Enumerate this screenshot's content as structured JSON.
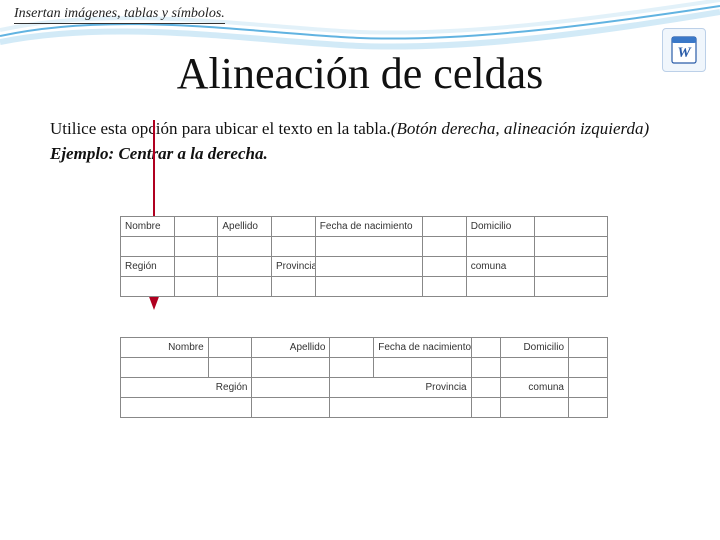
{
  "breadcrumb": "Insertan imágenes, tablas y símbolos.",
  "title": "Alineación de celdas",
  "body": {
    "line1": "Utilice esta opción para ubicar el texto en la tabla.",
    "paren": "(Botón derecha, alineación izquierda)",
    "example_label": "Ejemplo: Centrar a la derecha."
  },
  "icons": {
    "word": "word-icon"
  },
  "table_a": {
    "row1": [
      "Nombre",
      "",
      "Apellido",
      "",
      "Fecha de nacimiento",
      "",
      "Domicilio",
      ""
    ],
    "row2": [
      "",
      "",
      "",
      "",
      "",
      "",
      "",
      ""
    ],
    "row3": [
      "Región",
      "",
      "",
      "Provincia",
      "",
      "",
      "comuna",
      ""
    ],
    "row4": [
      "",
      "",
      "",
      "",
      "",
      "",
      "",
      ""
    ]
  },
  "table_b": {
    "row1": [
      "Nombre",
      "",
      "Apellido",
      "",
      "Fecha de nacimiento",
      "",
      "Domicilio",
      ""
    ],
    "row2": [
      "",
      "",
      "",
      "",
      "",
      "",
      "",
      ""
    ],
    "row3": [
      "Región",
      "",
      "",
      "Provincia",
      "",
      "",
      "comuna",
      ""
    ],
    "row4": [
      "",
      "",
      "",
      "",
      "",
      "",
      "",
      ""
    ]
  }
}
